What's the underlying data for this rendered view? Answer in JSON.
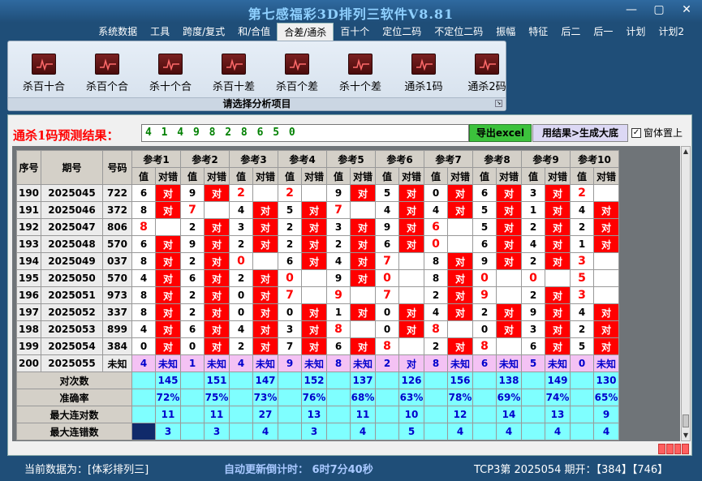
{
  "window": {
    "title": "第七感福彩3D排列三软件V8.81",
    "controls": [
      "—",
      "▢",
      "✕"
    ]
  },
  "menu": {
    "tabs": [
      "系统数据",
      "工具",
      "跨度/复式",
      "和/合值",
      "合差/通杀",
      "百十个",
      "定位二码",
      "不定位二码",
      "振幅",
      "特征",
      "后二",
      "后一",
      "计划",
      "计划2"
    ],
    "active_index": 4
  },
  "ribbon": {
    "buttons": [
      "杀百十合",
      "杀百个合",
      "杀十个合",
      "杀百十差",
      "杀百个差",
      "杀十个差",
      "通杀1码",
      "通杀2码"
    ],
    "footer": "请选择分析项目"
  },
  "result": {
    "label": "通杀1码预测结果：",
    "value": "4 1 4 9 8 2 8 6 5 0",
    "export_button": "导出excel",
    "generate_button": "用结果>生成大底",
    "topmost_label": "窗体置上",
    "topmost_checked": "✓"
  },
  "grid": {
    "headers": {
      "index": "序号",
      "period": "期号",
      "number": "号码",
      "refs": [
        "参考1",
        "参考2",
        "参考3",
        "参考4",
        "参考5",
        "参考6",
        "参考7",
        "参考8",
        "参考9",
        "参考10"
      ],
      "value": "值",
      "check": "对错"
    },
    "check_text": "对",
    "rows": [
      {
        "idx": "190",
        "period": "2025045",
        "num": "722",
        "vals": [
          "6",
          "9",
          "2",
          "2",
          "9",
          "5",
          "0",
          "6",
          "3",
          "2"
        ],
        "hits": [
          1,
          1,
          0,
          0,
          1,
          1,
          1,
          1,
          1,
          0
        ]
      },
      {
        "idx": "191",
        "period": "2025046",
        "num": "372",
        "vals": [
          "8",
          "7",
          "4",
          "5",
          "7",
          "4",
          "4",
          "5",
          "1",
          "4"
        ],
        "hits": [
          1,
          0,
          1,
          1,
          0,
          1,
          1,
          1,
          1,
          1
        ]
      },
      {
        "idx": "192",
        "period": "2025047",
        "num": "806",
        "vals": [
          "8",
          "2",
          "3",
          "2",
          "3",
          "9",
          "6",
          "5",
          "2",
          "2"
        ],
        "hits": [
          0,
          1,
          1,
          1,
          1,
          1,
          0,
          1,
          1,
          1
        ]
      },
      {
        "idx": "193",
        "period": "2025048",
        "num": "570",
        "vals": [
          "6",
          "9",
          "2",
          "2",
          "2",
          "6",
          "0",
          "6",
          "4",
          "1"
        ],
        "hits": [
          1,
          1,
          1,
          1,
          1,
          1,
          0,
          1,
          1,
          1
        ]
      },
      {
        "idx": "194",
        "period": "2025049",
        "num": "037",
        "vals": [
          "8",
          "2",
          "0",
          "6",
          "4",
          "7",
          "8",
          "9",
          "2",
          "3"
        ],
        "hits": [
          1,
          1,
          0,
          1,
          1,
          0,
          1,
          1,
          1,
          0
        ]
      },
      {
        "idx": "195",
        "period": "2025050",
        "num": "570",
        "vals": [
          "4",
          "6",
          "2",
          "0",
          "9",
          "0",
          "8",
          "0",
          "0",
          "5"
        ],
        "hits": [
          1,
          1,
          1,
          0,
          1,
          0,
          1,
          0,
          0,
          0
        ]
      },
      {
        "idx": "196",
        "period": "2025051",
        "num": "973",
        "vals": [
          "8",
          "2",
          "0",
          "7",
          "9",
          "7",
          "2",
          "9",
          "2",
          "3"
        ],
        "hits": [
          1,
          1,
          1,
          0,
          0,
          0,
          1,
          0,
          1,
          0
        ]
      },
      {
        "idx": "197",
        "period": "2025052",
        "num": "337",
        "vals": [
          "8",
          "2",
          "0",
          "0",
          "1",
          "0",
          "4",
          "2",
          "9",
          "4"
        ],
        "hits": [
          1,
          1,
          1,
          1,
          1,
          1,
          1,
          1,
          1,
          1
        ]
      },
      {
        "idx": "198",
        "period": "2025053",
        "num": "899",
        "vals": [
          "4",
          "6",
          "4",
          "3",
          "8",
          "0",
          "8",
          "0",
          "3",
          "2"
        ],
        "hits": [
          1,
          1,
          1,
          1,
          0,
          1,
          0,
          1,
          1,
          1
        ]
      },
      {
        "idx": "199",
        "period": "2025054",
        "num": "384",
        "vals": [
          "0",
          "0",
          "2",
          "7",
          "6",
          "8",
          "2",
          "8",
          "6",
          "5"
        ],
        "hits": [
          1,
          1,
          1,
          1,
          1,
          0,
          1,
          0,
          1,
          1
        ]
      }
    ],
    "pred_row": {
      "idx": "200",
      "period": "2025055",
      "num": "未知",
      "vals": [
        "4",
        "1",
        "4",
        "9",
        "8",
        "2",
        "8",
        "6",
        "5",
        "0"
      ],
      "checks": [
        "未知",
        "未知",
        "未知",
        "未知",
        "未知",
        "对",
        "未知",
        "未知",
        "未知",
        "未知"
      ]
    },
    "stats": [
      {
        "label": "对次数",
        "values": [
          "145",
          "151",
          "147",
          "152",
          "137",
          "126",
          "156",
          "138",
          "149",
          "130"
        ]
      },
      {
        "label": "准确率",
        "values": [
          "72%",
          "75%",
          "73%",
          "76%",
          "68%",
          "63%",
          "78%",
          "69%",
          "74%",
          "65%"
        ]
      },
      {
        "label": "最大连对数",
        "values": [
          "11",
          "11",
          "27",
          "13",
          "11",
          "10",
          "12",
          "14",
          "13",
          "9"
        ]
      },
      {
        "label": "最大连错数",
        "values": [
          "3",
          "3",
          "4",
          "3",
          "4",
          "5",
          "4",
          "4",
          "4",
          "4"
        ]
      }
    ]
  },
  "status": {
    "current_data": "当前数据为：[体彩排列三]",
    "countdown": "自动更新倒计时： 6时7分40秒",
    "draw_info": "TCP3第 2025054 期开：【384】【746】"
  }
}
